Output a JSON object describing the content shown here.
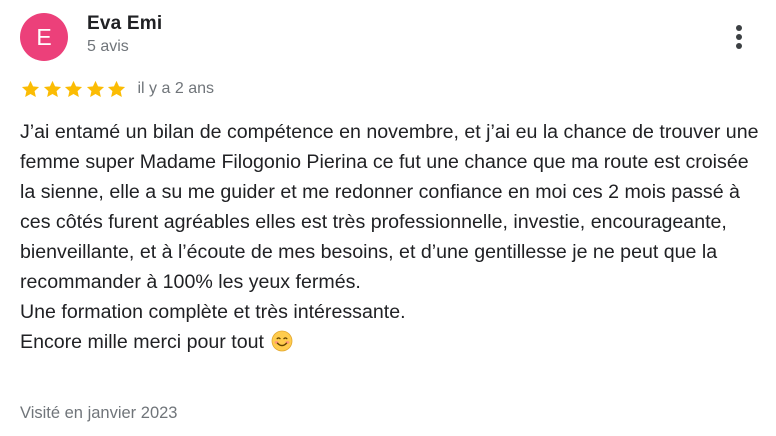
{
  "reviewer": {
    "initial": "E",
    "name": "Eva Emi",
    "review_count": "5 avis",
    "avatar_color": "#ec407a"
  },
  "menu": {
    "icon": "more-vert-icon"
  },
  "rating": {
    "stars": 5,
    "max_stars": 5,
    "star_color": "#fbbc04",
    "date": "il y a 2 ans"
  },
  "review": {
    "paragraphs": [
      "J’ai entamé un bilan de compétence en novembre, et j’ai eu la chance de trouver une femme super Madame Filogonio Pierina ce fut une chance que ma route est croisée la sienne, elle a su me guider et me redonner confiance en moi ces 2 mois passé à ces côtés furent agréables elles est très professionnelle, investie, encourageante, bienveillante, et à l’écoute de mes besoins, et d’une gentillesse je ne peut que la recommander à 100% les yeux fermés.",
      "Une formation complète et très intéressante.",
      "Encore mille merci pour tout"
    ],
    "closing_emoji": "smiling-face-icon"
  },
  "visited": "Visité en janvier 2023"
}
